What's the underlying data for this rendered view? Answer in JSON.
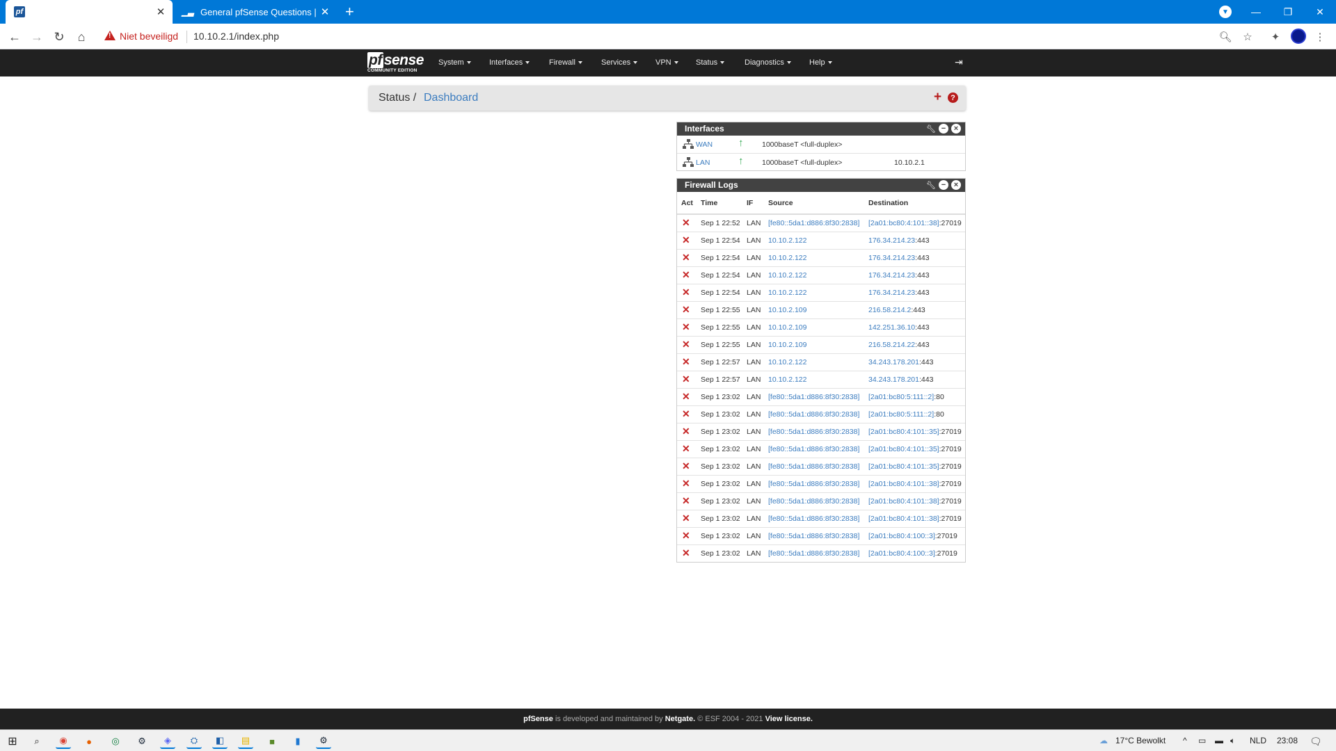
{
  "browser": {
    "tabs": [
      {
        "title": "",
        "favicon": "pf",
        "active": true
      },
      {
        "title": "General pfSense Questions | Net",
        "favicon": "netgate",
        "active": false
      }
    ],
    "security_label": "Niet beveiligd",
    "url": "10.10.2.1/index.php"
  },
  "pfsense": {
    "logo_main": "sense",
    "logo_pf": "pf",
    "logo_sub": "COMMUNITY EDITION",
    "menu": [
      "System",
      "Interfaces",
      "Firewall",
      "Services",
      "VPN",
      "Status",
      "Diagnostics",
      "Help"
    ]
  },
  "breadcrumb": {
    "section": "Status /",
    "page": "Dashboard"
  },
  "interfaces_widget": {
    "title": "Interfaces",
    "rows": [
      {
        "name": "WAN",
        "media": "1000baseT <full-duplex>",
        "ip": ""
      },
      {
        "name": "LAN",
        "media": "1000baseT <full-duplex>",
        "ip": "10.10.2.1"
      }
    ]
  },
  "firewall_widget": {
    "title": "Firewall Logs",
    "columns": [
      "Act",
      "Time",
      "IF",
      "Source",
      "Destination"
    ],
    "rows": [
      {
        "time": "Sep 1 22:52",
        "if": "LAN",
        "src": "[fe80::5da1:d886:8f30:2838]",
        "dst": "[2a01:bc80:4:101::38]",
        "port": ":27019"
      },
      {
        "time": "Sep 1 22:54",
        "if": "LAN",
        "src": "10.10.2.122",
        "dst": "176.34.214.23",
        "port": ":443"
      },
      {
        "time": "Sep 1 22:54",
        "if": "LAN",
        "src": "10.10.2.122",
        "dst": "176.34.214.23",
        "port": ":443"
      },
      {
        "time": "Sep 1 22:54",
        "if": "LAN",
        "src": "10.10.2.122",
        "dst": "176.34.214.23",
        "port": ":443"
      },
      {
        "time": "Sep 1 22:54",
        "if": "LAN",
        "src": "10.10.2.122",
        "dst": "176.34.214.23",
        "port": ":443"
      },
      {
        "time": "Sep 1 22:55",
        "if": "LAN",
        "src": "10.10.2.109",
        "dst": "216.58.214.2",
        "port": ":443"
      },
      {
        "time": "Sep 1 22:55",
        "if": "LAN",
        "src": "10.10.2.109",
        "dst": "142.251.36.10",
        "port": ":443"
      },
      {
        "time": "Sep 1 22:55",
        "if": "LAN",
        "src": "10.10.2.109",
        "dst": "216.58.214.22",
        "port": ":443"
      },
      {
        "time": "Sep 1 22:57",
        "if": "LAN",
        "src": "10.10.2.122",
        "dst": "34.243.178.201",
        "port": ":443"
      },
      {
        "time": "Sep 1 22:57",
        "if": "LAN",
        "src": "10.10.2.122",
        "dst": "34.243.178.201",
        "port": ":443"
      },
      {
        "time": "Sep 1 23:02",
        "if": "LAN",
        "src": "[fe80::5da1:d886:8f30:2838]",
        "dst": "[2a01:bc80:5:111::2]",
        "port": ":80"
      },
      {
        "time": "Sep 1 23:02",
        "if": "LAN",
        "src": "[fe80::5da1:d886:8f30:2838]",
        "dst": "[2a01:bc80:5:111::2]",
        "port": ":80"
      },
      {
        "time": "Sep 1 23:02",
        "if": "LAN",
        "src": "[fe80::5da1:d886:8f30:2838]",
        "dst": "[2a01:bc80:4:101::35]",
        "port": ":27019"
      },
      {
        "time": "Sep 1 23:02",
        "if": "LAN",
        "src": "[fe80::5da1:d886:8f30:2838]",
        "dst": "[2a01:bc80:4:101::35]",
        "port": ":27019"
      },
      {
        "time": "Sep 1 23:02",
        "if": "LAN",
        "src": "[fe80::5da1:d886:8f30:2838]",
        "dst": "[2a01:bc80:4:101::35]",
        "port": ":27019"
      },
      {
        "time": "Sep 1 23:02",
        "if": "LAN",
        "src": "[fe80::5da1:d886:8f30:2838]",
        "dst": "[2a01:bc80:4:101::38]",
        "port": ":27019"
      },
      {
        "time": "Sep 1 23:02",
        "if": "LAN",
        "src": "[fe80::5da1:d886:8f30:2838]",
        "dst": "[2a01:bc80:4:101::38]",
        "port": ":27019"
      },
      {
        "time": "Sep 1 23:02",
        "if": "LAN",
        "src": "[fe80::5da1:d886:8f30:2838]",
        "dst": "[2a01:bc80:4:101::38]",
        "port": ":27019"
      },
      {
        "time": "Sep 1 23:02",
        "if": "LAN",
        "src": "[fe80::5da1:d886:8f30:2838]",
        "dst": "[2a01:bc80:4:100::3]",
        "port": ":27019"
      },
      {
        "time": "Sep 1 23:02",
        "if": "LAN",
        "src": "[fe80::5da1:d886:8f30:2838]",
        "dst": "[2a01:bc80:4:100::3]",
        "port": ":27019"
      }
    ]
  },
  "footer": {
    "brand": "pfSense",
    "middle": " is developed and maintained by ",
    "company": "Netgate.",
    "copyright": " © ESF 2004 - 2021 ",
    "license": "View license."
  },
  "taskbar": {
    "weather": "17°C  Bewolkt",
    "lang": "NLD",
    "time": "23:08"
  },
  "colors": {
    "accent": "#0078d7",
    "nav": "#212121",
    "link": "#3b7cbf",
    "block": "#c62828"
  }
}
